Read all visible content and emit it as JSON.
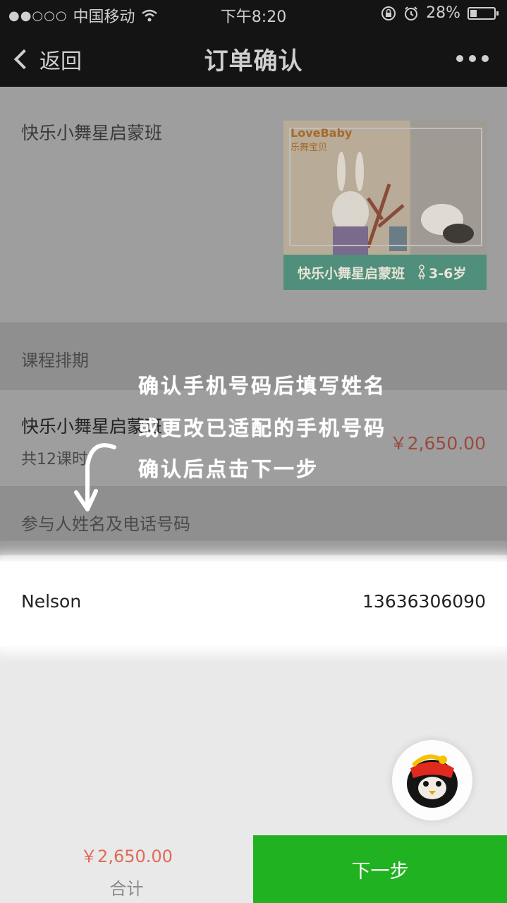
{
  "status_bar": {
    "carrier_signal": "●●○○○",
    "carrier": "中国移动",
    "wifi_icon": "wifi-icon",
    "time": "下午8:20",
    "battery_percent": "28%",
    "battery_level": 0.28
  },
  "nav": {
    "back_label": "返回",
    "title": "订单确认",
    "more_icon": "more-dots-icon"
  },
  "course": {
    "name": "快乐小舞星启蒙班",
    "thumbnail": {
      "brand": "LoveBaby",
      "brand_cn": "乐舞宝贝",
      "banner_text": "快乐小舞星启蒙班",
      "age_range": "3-6岁"
    }
  },
  "schedule": {
    "header": "课程排期",
    "item_name": "快乐小舞星启蒙班",
    "count": "共12课时",
    "price": "￥2,650.00"
  },
  "participants": {
    "header": "参与人姓名及电话号码",
    "name": "Nelson",
    "phone": "13636306090"
  },
  "overlay": {
    "line1": "确认手机号码后填写姓名",
    "line2": "或更改已适配的手机号码",
    "line3": "确认后点击下一步"
  },
  "footer": {
    "total_amount": "￥2,650.00",
    "total_label": "合计",
    "next_button": "下一步"
  },
  "colors": {
    "next_green": "#21b221",
    "price_red": "#e06b56",
    "nav_bg": "#141414"
  }
}
